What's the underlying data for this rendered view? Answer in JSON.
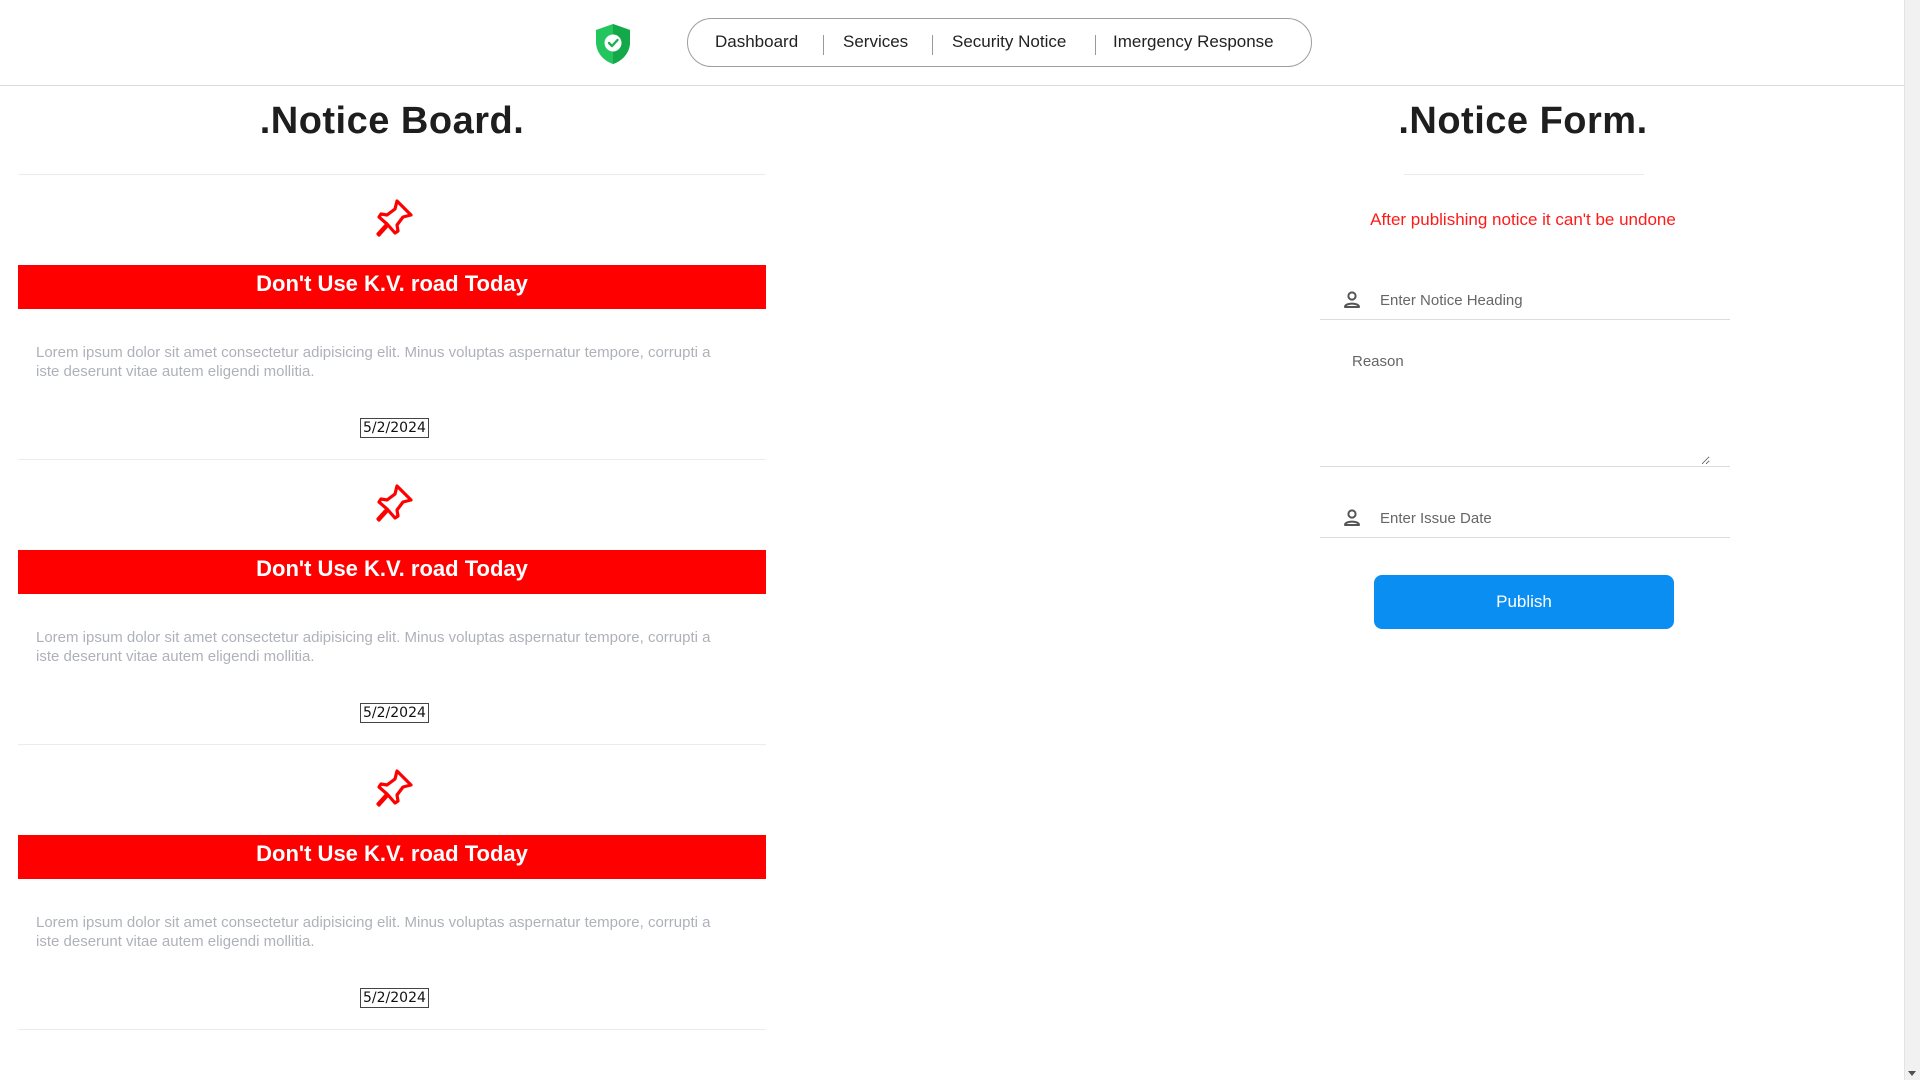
{
  "header": {
    "logo_icon": "shield-check-icon",
    "nav": [
      {
        "label": "Dashboard"
      },
      {
        "label": "Services"
      },
      {
        "label": "Security Notice"
      },
      {
        "label": "Imergency Response"
      }
    ]
  },
  "board": {
    "title": ".Notice Board.",
    "notices": [
      {
        "icon": "pin-icon",
        "heading": "Don't Use K.V. road Today",
        "body": "Lorem ipsum dolor sit amet consectetur adipisicing elit. Minus voluptas aspernatur tempore, corrupti a iste deserunt vitae autem eligendi mollitia.",
        "date": "5/2/2024"
      },
      {
        "icon": "pin-icon",
        "heading": "Don't Use K.V. road Today",
        "body": "Lorem ipsum dolor sit amet consectetur adipisicing elit. Minus voluptas aspernatur tempore, corrupti a iste deserunt vitae autem eligendi mollitia.",
        "date": "5/2/2024"
      },
      {
        "icon": "pin-icon",
        "heading": "Don't Use K.V. road Today",
        "body": "Lorem ipsum dolor sit amet consectetur adipisicing elit. Minus voluptas aspernatur tempore, corrupti a iste deserunt vitae autem eligendi mollitia.",
        "date": "5/2/2024"
      }
    ]
  },
  "form": {
    "title": ".Notice Form.",
    "warning": "After publishing notice it can't be undone",
    "heading_placeholder": "Enter Notice Heading",
    "reason_placeholder": "Reason",
    "date_placeholder": "Enter Issue Date",
    "publish_label": "Publish",
    "field_icon": "user-icon"
  },
  "colors": {
    "accent_red": "#ff0000",
    "publish_blue": "#0a8ef2",
    "logo_green": "#22c55e"
  }
}
